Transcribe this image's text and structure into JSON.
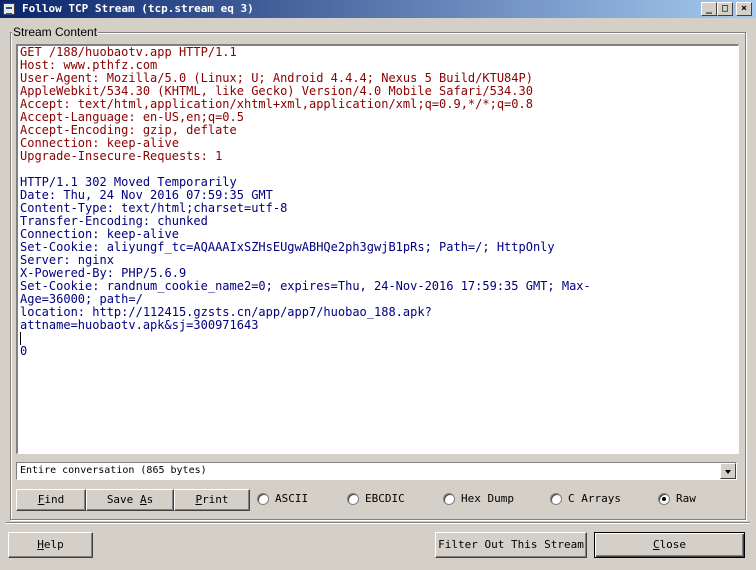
{
  "window": {
    "title": "Follow TCP Stream (tcp.stream eq 3)",
    "min_glyph": "_",
    "max_glyph": "□",
    "close_glyph": "×"
  },
  "stream_group_label": "Stream Content",
  "request_lines": [
    "GET /188/huobaotv.app HTTP/1.1",
    "Host: www.pthfz.com",
    "User-Agent: Mozilla/5.0 (Linux; U; Android 4.4.4; Nexus 5 Build/KTU84P)",
    "AppleWebkit/534.30 (KHTML, like Gecko) Version/4.0 Mobile Safari/534.30",
    "Accept: text/html,application/xhtml+xml,application/xml;q=0.9,*/*;q=0.8",
    "Accept-Language: en-US,en;q=0.5",
    "Accept-Encoding: gzip, deflate",
    "Connection: keep-alive",
    "Upgrade-Insecure-Requests: 1"
  ],
  "response_lines": [
    "HTTP/1.1 302 Moved Temporarily",
    "Date: Thu, 24 Nov 2016 07:59:35 GMT",
    "Content-Type: text/html;charset=utf-8",
    "Transfer-Encoding: chunked",
    "Connection: keep-alive",
    "Set-Cookie: aliyungf_tc=AQAAAIxSZHsEUgwABHQe2ph3gwjB1pRs; Path=/; HttpOnly",
    "Server: nginx",
    "X-Powered-By: PHP/5.6.9",
    "Set-Cookie: randnum_cookie_name2=0; expires=Thu, 24-Nov-2016 17:59:35 GMT; Max-",
    "Age=36000; path=/",
    "location: http://112415.gzsts.cn/app/app7/huobao_188.apk?",
    "attname=huobaotv.apk&sj=300971643"
  ],
  "trailer_lines": [
    "",
    "0"
  ],
  "conversation_select": {
    "value": "Entire conversation (865 bytes)"
  },
  "buttons": {
    "find": {
      "pre": "",
      "u": "F",
      "post": "ind"
    },
    "save_as": {
      "pre": "Save ",
      "u": "A",
      "post": "s"
    },
    "print": {
      "pre": "",
      "u": "P",
      "post": "rint"
    },
    "help": {
      "pre": "",
      "u": "H",
      "post": "elp"
    },
    "filter": "Filter Out This Stream",
    "close": {
      "pre": "",
      "u": "C",
      "post": "lose"
    }
  },
  "format_options": [
    {
      "label": "ASCII",
      "selected": false
    },
    {
      "label": "EBCDIC",
      "selected": false
    },
    {
      "label": "Hex Dump",
      "selected": false
    },
    {
      "label": "C Arrays",
      "selected": false
    },
    {
      "label": "Raw",
      "selected": true
    }
  ],
  "colors": {
    "client_text": "#8b0000",
    "server_text": "#00007f",
    "titlebar_start": "#0a246a",
    "titlebar_end": "#a6caf0"
  }
}
